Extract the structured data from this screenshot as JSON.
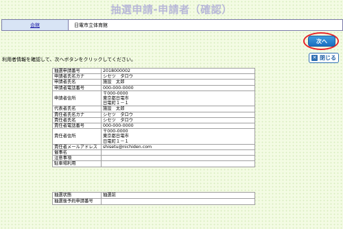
{
  "header": {
    "title": "抽選申請-申請者（確認）"
  },
  "venue": {
    "label": "会館",
    "value": "日電市立体育館"
  },
  "actions": {
    "next_label": "次へ",
    "close_label": "閉じる",
    "close_glyph": "✕"
  },
  "instruction": "利用者情報を確認して、次へボタンをクリックしてください。",
  "info_rows": [
    {
      "label": "抽選申請番号",
      "value": "2018000002"
    },
    {
      "label": "申請者氏名カナ",
      "value": "シセツ　タロウ"
    },
    {
      "label": "申請者氏名",
      "value": "施設　太郎"
    },
    {
      "label": "申請者電話番号",
      "value": "000-000-0000"
    },
    {
      "label": "申請者住所",
      "value": "〒000-0000\n東京都日電市\n日電町１－１"
    },
    {
      "label": "代表者氏名",
      "value": "施設　太郎"
    },
    {
      "label": "責任者氏名カナ",
      "value": "シセツ　タロウ"
    },
    {
      "label": "責任者氏名",
      "value": "シセツ　タロウ"
    },
    {
      "label": "責任者電話番号",
      "value": "000-000-0000"
    },
    {
      "label": "責任者住所",
      "value": "〒000-0000\n東京都日電市\n日電町１－１"
    },
    {
      "label": "責任者メールアドレス",
      "value": "shisetu@nichiden.com"
    },
    {
      "label": "催事名",
      "value": ""
    },
    {
      "label": "注意事項",
      "value": ""
    },
    {
      "label": "駐車場利用",
      "value": ""
    }
  ],
  "status_rows": [
    {
      "label": "抽選状態",
      "value": "抽選前"
    },
    {
      "label": "抽選後予約申請番号",
      "value": ""
    }
  ],
  "colors": {
    "background": "#f3fbe3",
    "title": "#b7b7d7",
    "accent_ring": "#e8242a",
    "button_blue": "#1a6fc0"
  }
}
